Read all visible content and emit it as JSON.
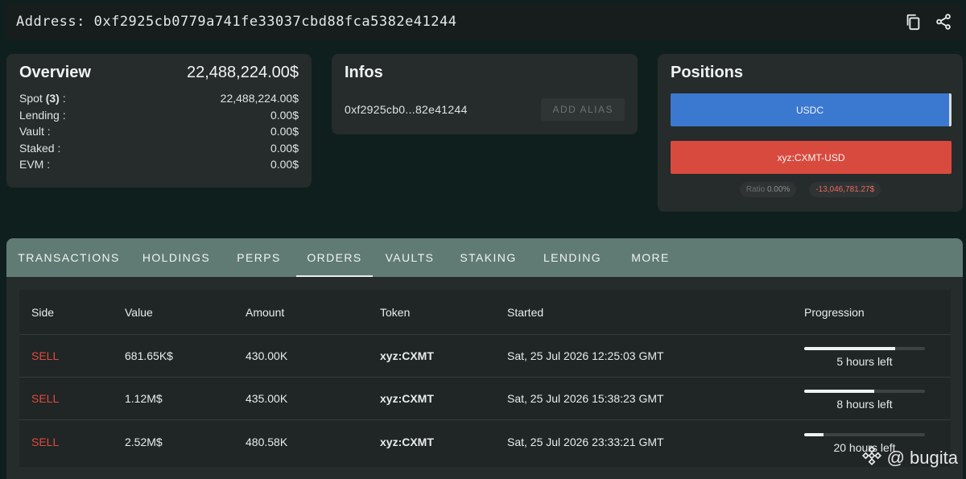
{
  "header": {
    "address_label": "Address: 0xf2925cb0779a741fe33037cbd88fca5382e41244",
    "copy_icon": "copy-icon",
    "share_icon": "share-icon"
  },
  "overview": {
    "title": "Overview",
    "total": "22,488,224.00$",
    "rows": [
      {
        "label": "Spot ",
        "count": "(3)",
        "suffix": " :",
        "value": "22,488,224.00$"
      },
      {
        "label": "Lending :",
        "value": "0.00$"
      },
      {
        "label": "Vault :",
        "value": "0.00$"
      },
      {
        "label": "Staked :",
        "value": "0.00$"
      },
      {
        "label": "EVM :",
        "value": "0.00$"
      }
    ]
  },
  "infos": {
    "title": "Infos",
    "short_address": "0xf2925cb0...82e41244",
    "alias_button": "ADD ALIAS"
  },
  "positions": {
    "title": "Positions",
    "bars": [
      {
        "label": "USDC",
        "color": "#3b78cf"
      },
      {
        "label": "xyz:CXMT-USD",
        "color": "#d94a3e"
      }
    ],
    "ratio_label": "Ratio",
    "ratio_value": "0.00%",
    "pnl": "-13,046,781.27$"
  },
  "tabs": [
    {
      "label": "TRANSACTIONS",
      "active": false
    },
    {
      "label": "HOLDINGS",
      "active": false
    },
    {
      "label": "PERPS",
      "active": false
    },
    {
      "label": "ORDERS",
      "active": true
    },
    {
      "label": "VAULTS",
      "active": false
    },
    {
      "label": "STAKING",
      "active": false
    },
    {
      "label": "LENDING",
      "active": false
    },
    {
      "label": "MORE",
      "active": false
    }
  ],
  "orders": {
    "columns": [
      "Side",
      "Value",
      "Amount",
      "Token",
      "Started",
      "Progression"
    ],
    "rows": [
      {
        "side": "SELL",
        "value": "681.65K$",
        "amount": "430.00K",
        "token": "xyz:CXMT",
        "started": "Sat, 25 Jul 2026 12:25:03 GMT",
        "progress": 0.75,
        "remaining": "5 hours left"
      },
      {
        "side": "SELL",
        "value": "1.12M$",
        "amount": "435.00K",
        "token": "xyz:CXMT",
        "started": "Sat, 25 Jul 2026 15:38:23 GMT",
        "progress": 0.58,
        "remaining": "8 hours left"
      },
      {
        "side": "SELL",
        "value": "2.52M$",
        "amount": "480.58K",
        "token": "xyz:CXMT",
        "started": "Sat, 25 Jul 2026 23:33:21 GMT",
        "progress": 0.16,
        "remaining": "20 hours left"
      }
    ]
  },
  "watermark": {
    "text": "@ bugita",
    "icon": "binance-logo-icon"
  }
}
